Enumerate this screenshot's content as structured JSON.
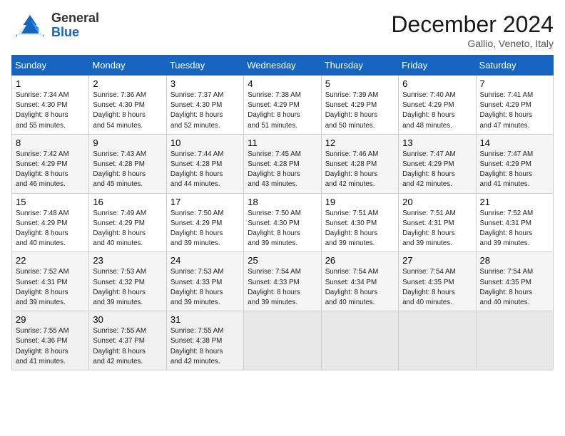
{
  "header": {
    "logo_general": "General",
    "logo_blue": "Blue",
    "month": "December 2024",
    "location": "Gallio, Veneto, Italy"
  },
  "days_of_week": [
    "Sunday",
    "Monday",
    "Tuesday",
    "Wednesday",
    "Thursday",
    "Friday",
    "Saturday"
  ],
  "weeks": [
    [
      {
        "date": "1",
        "sunrise": "Sunrise: 7:34 AM",
        "sunset": "Sunset: 4:30 PM",
        "daylight": "Daylight: 8 hours and 55 minutes."
      },
      {
        "date": "2",
        "sunrise": "Sunrise: 7:36 AM",
        "sunset": "Sunset: 4:30 PM",
        "daylight": "Daylight: 8 hours and 54 minutes."
      },
      {
        "date": "3",
        "sunrise": "Sunrise: 7:37 AM",
        "sunset": "Sunset: 4:30 PM",
        "daylight": "Daylight: 8 hours and 52 minutes."
      },
      {
        "date": "4",
        "sunrise": "Sunrise: 7:38 AM",
        "sunset": "Sunset: 4:29 PM",
        "daylight": "Daylight: 8 hours and 51 minutes."
      },
      {
        "date": "5",
        "sunrise": "Sunrise: 7:39 AM",
        "sunset": "Sunset: 4:29 PM",
        "daylight": "Daylight: 8 hours and 50 minutes."
      },
      {
        "date": "6",
        "sunrise": "Sunrise: 7:40 AM",
        "sunset": "Sunset: 4:29 PM",
        "daylight": "Daylight: 8 hours and 48 minutes."
      },
      {
        "date": "7",
        "sunrise": "Sunrise: 7:41 AM",
        "sunset": "Sunset: 4:29 PM",
        "daylight": "Daylight: 8 hours and 47 minutes."
      }
    ],
    [
      {
        "date": "8",
        "sunrise": "Sunrise: 7:42 AM",
        "sunset": "Sunset: 4:29 PM",
        "daylight": "Daylight: 8 hours and 46 minutes."
      },
      {
        "date": "9",
        "sunrise": "Sunrise: 7:43 AM",
        "sunset": "Sunset: 4:28 PM",
        "daylight": "Daylight: 8 hours and 45 minutes."
      },
      {
        "date": "10",
        "sunrise": "Sunrise: 7:44 AM",
        "sunset": "Sunset: 4:28 PM",
        "daylight": "Daylight: 8 hours and 44 minutes."
      },
      {
        "date": "11",
        "sunrise": "Sunrise: 7:45 AM",
        "sunset": "Sunset: 4:28 PM",
        "daylight": "Daylight: 8 hours and 43 minutes."
      },
      {
        "date": "12",
        "sunrise": "Sunrise: 7:46 AM",
        "sunset": "Sunset: 4:28 PM",
        "daylight": "Daylight: 8 hours and 42 minutes."
      },
      {
        "date": "13",
        "sunrise": "Sunrise: 7:47 AM",
        "sunset": "Sunset: 4:29 PM",
        "daylight": "Daylight: 8 hours and 42 minutes."
      },
      {
        "date": "14",
        "sunrise": "Sunrise: 7:47 AM",
        "sunset": "Sunset: 4:29 PM",
        "daylight": "Daylight: 8 hours and 41 minutes."
      }
    ],
    [
      {
        "date": "15",
        "sunrise": "Sunrise: 7:48 AM",
        "sunset": "Sunset: 4:29 PM",
        "daylight": "Daylight: 8 hours and 40 minutes."
      },
      {
        "date": "16",
        "sunrise": "Sunrise: 7:49 AM",
        "sunset": "Sunset: 4:29 PM",
        "daylight": "Daylight: 8 hours and 40 minutes."
      },
      {
        "date": "17",
        "sunrise": "Sunrise: 7:50 AM",
        "sunset": "Sunset: 4:29 PM",
        "daylight": "Daylight: 8 hours and 39 minutes."
      },
      {
        "date": "18",
        "sunrise": "Sunrise: 7:50 AM",
        "sunset": "Sunset: 4:30 PM",
        "daylight": "Daylight: 8 hours and 39 minutes."
      },
      {
        "date": "19",
        "sunrise": "Sunrise: 7:51 AM",
        "sunset": "Sunset: 4:30 PM",
        "daylight": "Daylight: 8 hours and 39 minutes."
      },
      {
        "date": "20",
        "sunrise": "Sunrise: 7:51 AM",
        "sunset": "Sunset: 4:31 PM",
        "daylight": "Daylight: 8 hours and 39 minutes."
      },
      {
        "date": "21",
        "sunrise": "Sunrise: 7:52 AM",
        "sunset": "Sunset: 4:31 PM",
        "daylight": "Daylight: 8 hours and 39 minutes."
      }
    ],
    [
      {
        "date": "22",
        "sunrise": "Sunrise: 7:52 AM",
        "sunset": "Sunset: 4:31 PM",
        "daylight": "Daylight: 8 hours and 39 minutes."
      },
      {
        "date": "23",
        "sunrise": "Sunrise: 7:53 AM",
        "sunset": "Sunset: 4:32 PM",
        "daylight": "Daylight: 8 hours and 39 minutes."
      },
      {
        "date": "24",
        "sunrise": "Sunrise: 7:53 AM",
        "sunset": "Sunset: 4:33 PM",
        "daylight": "Daylight: 8 hours and 39 minutes."
      },
      {
        "date": "25",
        "sunrise": "Sunrise: 7:54 AM",
        "sunset": "Sunset: 4:33 PM",
        "daylight": "Daylight: 8 hours and 39 minutes."
      },
      {
        "date": "26",
        "sunrise": "Sunrise: 7:54 AM",
        "sunset": "Sunset: 4:34 PM",
        "daylight": "Daylight: 8 hours and 40 minutes."
      },
      {
        "date": "27",
        "sunrise": "Sunrise: 7:54 AM",
        "sunset": "Sunset: 4:35 PM",
        "daylight": "Daylight: 8 hours and 40 minutes."
      },
      {
        "date": "28",
        "sunrise": "Sunrise: 7:54 AM",
        "sunset": "Sunset: 4:35 PM",
        "daylight": "Daylight: 8 hours and 40 minutes."
      }
    ],
    [
      {
        "date": "29",
        "sunrise": "Sunrise: 7:55 AM",
        "sunset": "Sunset: 4:36 PM",
        "daylight": "Daylight: 8 hours and 41 minutes."
      },
      {
        "date": "30",
        "sunrise": "Sunrise: 7:55 AM",
        "sunset": "Sunset: 4:37 PM",
        "daylight": "Daylight: 8 hours and 42 minutes."
      },
      {
        "date": "31",
        "sunrise": "Sunrise: 7:55 AM",
        "sunset": "Sunset: 4:38 PM",
        "daylight": "Daylight: 8 hours and 42 minutes."
      },
      null,
      null,
      null,
      null
    ]
  ]
}
